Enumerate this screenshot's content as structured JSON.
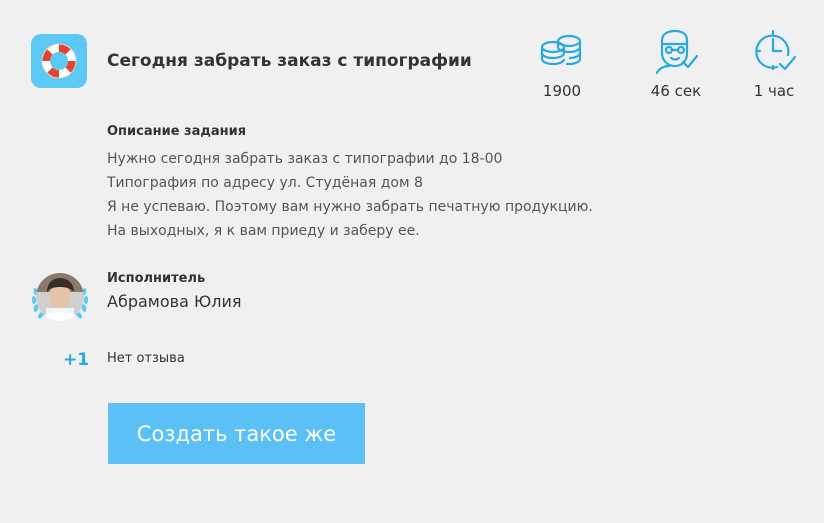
{
  "task": {
    "title": "Сегодня забрать заказ с типографии",
    "icon": "lifebuoy-icon"
  },
  "stats": {
    "reward": {
      "icon": "coins-icon",
      "value": "1900"
    },
    "response_time": {
      "icon": "executor-check-icon",
      "value": "46 сек"
    },
    "duration": {
      "icon": "clock-check-icon",
      "value": "1 час"
    }
  },
  "description": {
    "heading": "Описание задания",
    "lines": [
      "Нужно сегодня забрать заказ с типографии до 18-00",
      "Типография по адресу ул. Студёная дом 8",
      "Я не успеваю. Поэтому вам нужно забрать печатную продукцию.",
      "На выходных, я к вам приеду и заберу ее."
    ]
  },
  "executor": {
    "heading": "Исполнитель",
    "name": "Абрамова Юлия"
  },
  "review": {
    "rating": "+1",
    "text": "Нет отзыва"
  },
  "actions": {
    "create_label": "Создать такое же"
  },
  "colors": {
    "accent": "#5bc0f5",
    "icon_blue": "#29a9e1",
    "lifebuoy_red": "#e8412c",
    "background": "#f0f0f0"
  }
}
